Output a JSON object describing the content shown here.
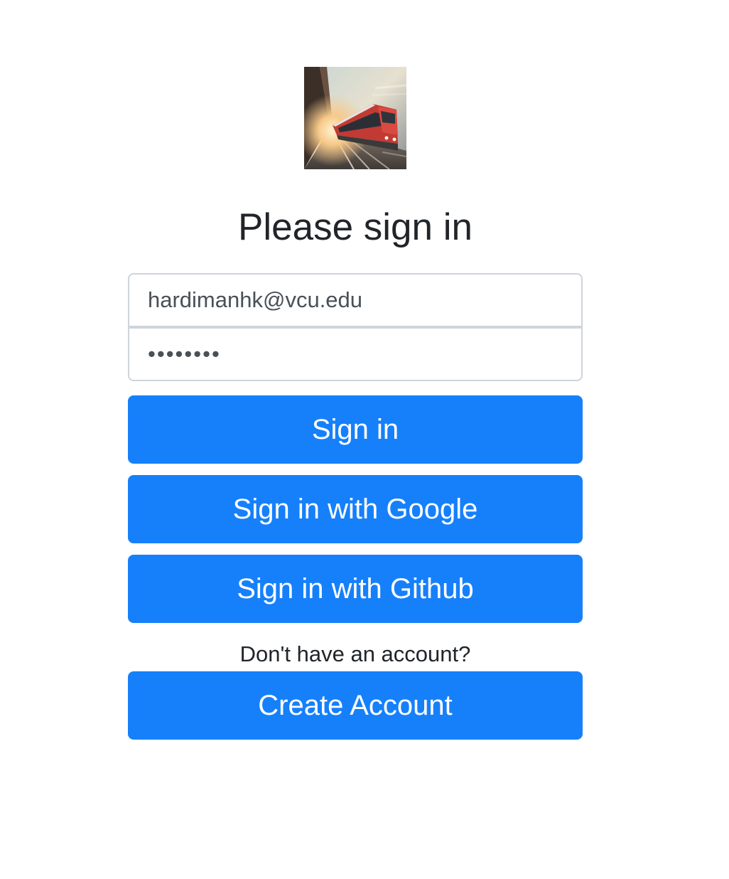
{
  "form": {
    "title": "Please sign in",
    "email": {
      "value": "hardimanhk@vcu.edu"
    },
    "password": {
      "value": "••••••••"
    },
    "buttons": {
      "sign_in": "Sign in",
      "sign_in_google": "Sign in with Google",
      "sign_in_github": "Sign in with Github",
      "create_account": "Create Account"
    },
    "account_prompt": "Don't have an account?"
  },
  "logo": {
    "icon": "train-photo-icon"
  },
  "colors": {
    "primary": "#1680fb",
    "input_border": "#ced4da",
    "text": "#212529",
    "input_text": "#495057"
  }
}
